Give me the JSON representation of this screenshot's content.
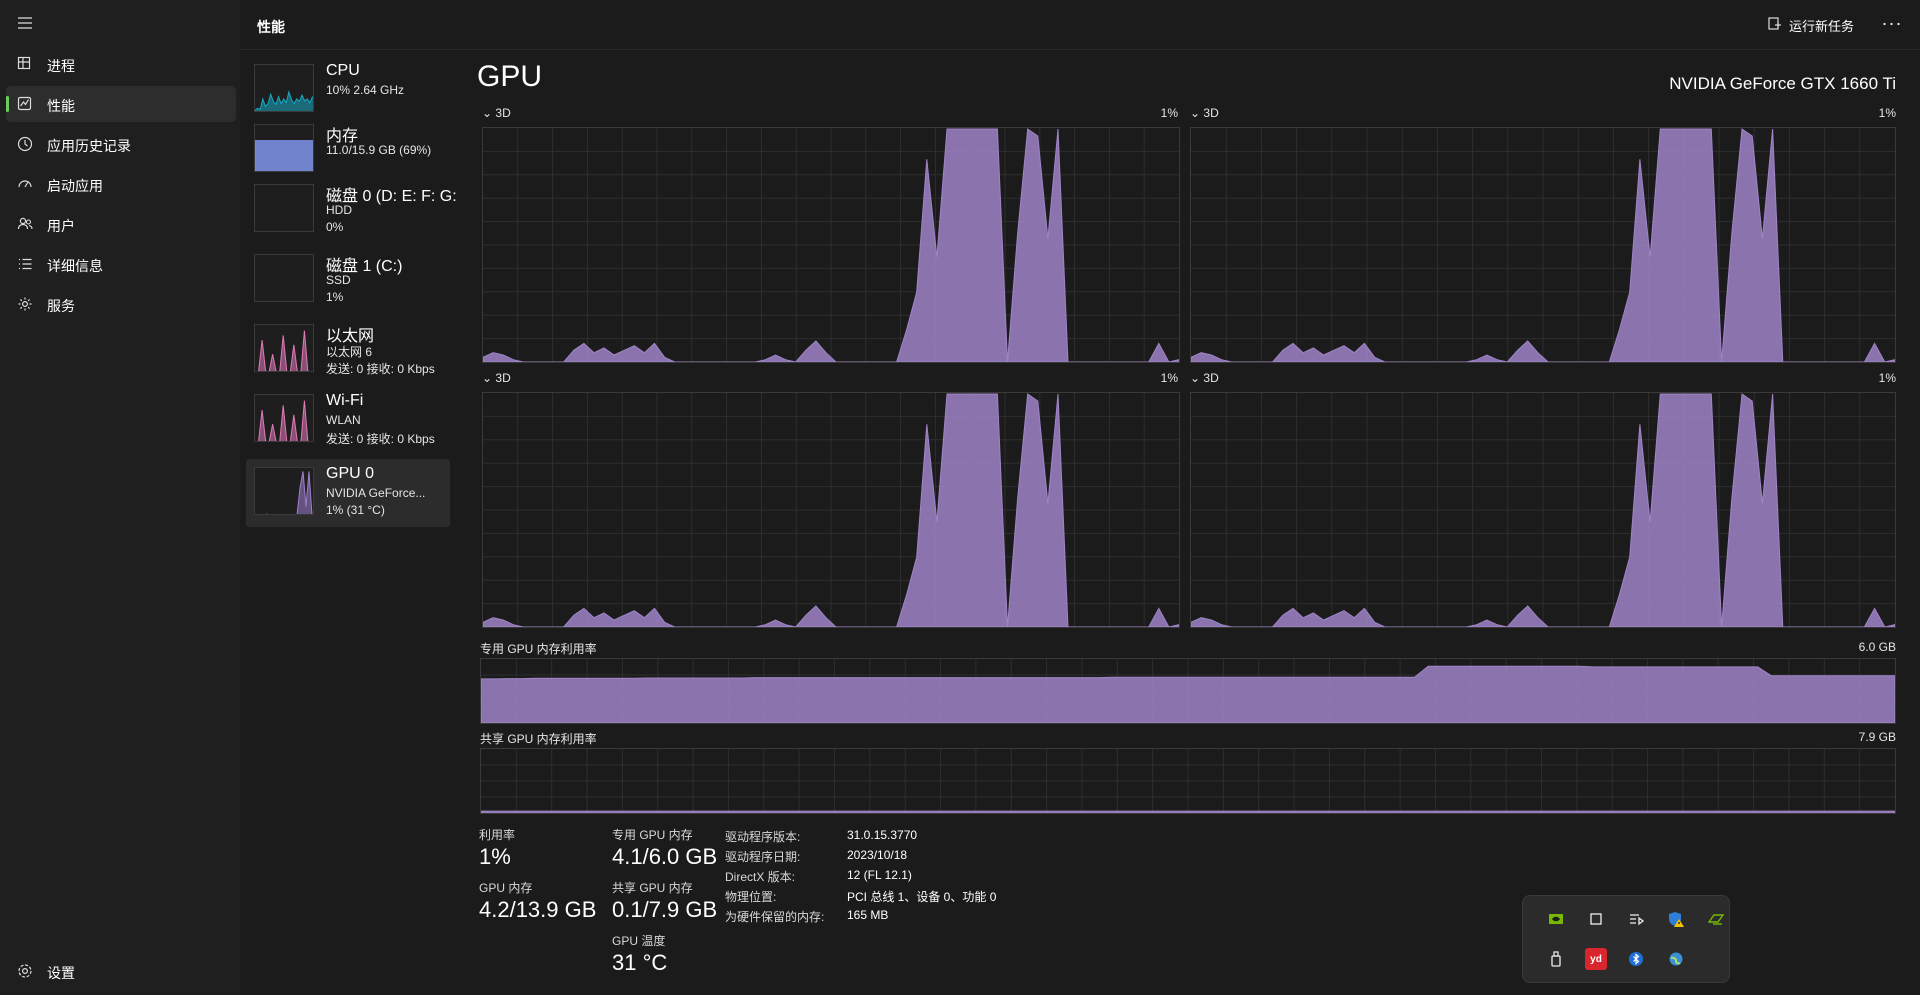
{
  "header": {
    "title": "性能",
    "run_task": "运行新任务"
  },
  "nav": {
    "items": [
      {
        "label": "进程",
        "icon": "processes-icon"
      },
      {
        "label": "性能",
        "icon": "performance-icon",
        "active": true
      },
      {
        "label": "应用历史记录",
        "icon": "app-history-icon"
      },
      {
        "label": "启动应用",
        "icon": "startup-apps-icon"
      },
      {
        "label": "用户",
        "icon": "users-icon"
      },
      {
        "label": "详细信息",
        "icon": "details-icon"
      },
      {
        "label": "服务",
        "icon": "services-icon"
      }
    ],
    "settings": "设置"
  },
  "devices": [
    {
      "name": "CPU",
      "l2": "10% 2.64 GHz",
      "l3": "",
      "color": "#17a9c4"
    },
    {
      "name": "内存",
      "l2": "11.0/15.9 GB (69%)",
      "l3": "",
      "color": "#7a8ee0"
    },
    {
      "name": "磁盘 0 (D: E: F: G:",
      "l2": "HDD",
      "l3": "0%",
      "color": "#6cbd5a"
    },
    {
      "name": "磁盘 1 (C:)",
      "l2": "SSD",
      "l3": "1%",
      "color": "#6cbd5a"
    },
    {
      "name": "以太网",
      "l2": "以太网 6",
      "l3": "发送: 0 接收: 0 Kbps",
      "color": "#e07ab8"
    },
    {
      "name": "Wi-Fi",
      "l2": "WLAN",
      "l3": "发送: 0 接收: 0 Kbps",
      "color": "#e07ab8"
    },
    {
      "name": "GPU 0",
      "l2": "NVIDIA GeForce...",
      "l3": "1% (31 °C)",
      "color": "#a07fd0",
      "active": true
    }
  ],
  "gpu": {
    "title": "GPU",
    "model": "NVIDIA GeForce GTX 1660 Ti",
    "engines": [
      {
        "label": "3D",
        "pct": "1%"
      },
      {
        "label": "3D",
        "pct": "1%"
      },
      {
        "label": "3D",
        "pct": "1%"
      },
      {
        "label": "3D",
        "pct": "1%"
      }
    ],
    "dedicated_label": "专用 GPU 内存利用率",
    "dedicated_max": "6.0 GB",
    "shared_label": "共享 GPU 内存利用率",
    "shared_max": "7.9 GB",
    "graph_color": "#9f84c7",
    "engine_history": [
      2,
      4,
      3,
      1,
      0,
      0,
      0,
      0,
      0,
      5,
      8,
      4,
      6,
      3,
      5,
      7,
      4,
      8,
      2,
      0,
      0,
      0,
      0,
      0,
      0,
      0,
      0,
      0,
      1,
      3,
      1,
      0,
      5,
      9,
      4,
      0,
      0,
      0,
      0,
      0,
      0,
      0,
      14,
      30,
      87,
      45,
      100,
      100,
      100,
      100,
      100,
      100,
      0,
      55,
      100,
      97,
      53,
      100,
      0,
      0,
      0,
      0,
      0,
      0,
      0,
      0,
      0,
      8,
      0,
      1
    ],
    "dedicated_history": [
      70,
      70,
      70.5,
      70.5,
      71,
      71,
      71,
      71,
      71,
      71,
      71,
      71,
      71.5,
      71.5,
      71.5,
      71.5,
      71.5,
      71.5,
      71.5,
      71.5,
      72,
      72,
      72,
      72,
      72,
      72,
      72,
      72,
      72,
      72,
      72,
      72,
      72,
      72,
      72,
      72,
      72,
      72,
      72,
      72,
      72,
      72,
      72,
      72,
      72,
      72,
      72.5,
      72.5,
      72.5,
      72.5,
      72.5,
      72.5,
      72.5,
      72.5,
      72.5,
      72.5,
      72.5,
      72.5,
      72.5,
      72.5,
      72.5,
      72.5,
      72.5,
      72.5,
      72.5,
      72.5,
      72.5,
      72.5,
      72.5,
      90,
      90,
      90,
      90,
      90,
      90,
      90,
      90,
      90,
      90,
      90,
      90,
      89,
      89,
      89,
      89,
      89,
      89,
      89,
      89,
      89,
      89,
      89,
      89,
      89,
      75,
      75,
      75,
      75,
      75,
      75,
      75,
      75,
      75,
      75
    ],
    "shared_history": [
      3,
      3,
      3,
      3,
      3,
      3,
      3,
      3,
      3,
      3,
      3,
      3,
      3,
      3,
      3,
      3,
      3,
      3,
      3,
      3,
      3,
      3,
      3,
      3,
      3,
      3,
      3,
      3,
      3,
      3,
      3,
      3,
      3,
      3,
      3,
      3,
      3,
      3,
      3,
      3,
      3,
      3,
      3,
      3,
      3,
      3,
      3,
      3,
      3,
      3,
      3,
      3,
      3,
      3,
      3,
      3,
      3,
      3,
      3,
      3,
      3,
      3,
      3,
      3,
      3,
      3,
      3,
      3,
      3,
      3,
      3,
      3,
      3,
      3,
      3,
      3,
      3,
      3,
      3,
      3,
      3,
      3,
      3,
      3,
      3,
      3,
      3,
      3,
      3,
      3,
      3,
      3,
      3,
      3,
      3,
      3,
      3,
      3,
      3,
      3
    ]
  },
  "stats": {
    "utilization_label": "利用率",
    "utilization_value": "1%",
    "gpu_memory_label": "GPU 内存",
    "gpu_memory_value": "4.2/13.9 GB",
    "dedicated_label": "专用 GPU 内存",
    "dedicated_value": "4.1/6.0 GB",
    "shared_label": "共享 GPU 内存",
    "shared_value": "0.1/7.9 GB",
    "temp_label": "GPU 温度",
    "temp_value": "31 °C"
  },
  "props": [
    {
      "k": "驱动程序版本:",
      "v": "31.0.15.3770"
    },
    {
      "k": "驱动程序日期:",
      "v": "2023/10/18"
    },
    {
      "k": "DirectX 版本:",
      "v": "12 (FL 12.1)"
    },
    {
      "k": "物理位置:",
      "v": "PCI 总线 1、设备 0、功能 0"
    },
    {
      "k": "为硬件保留的内存:",
      "v": "165 MB"
    }
  ],
  "tray": {
    "icons": [
      "nvidia-icon",
      "window-icon",
      "cast-icon",
      "defender-warning-icon",
      "gpu-tweak-icon",
      "usb-eject-icon",
      "yd-app-icon",
      "bluetooth-icon",
      "network-globe-icon"
    ],
    "yd_text": "yd"
  }
}
